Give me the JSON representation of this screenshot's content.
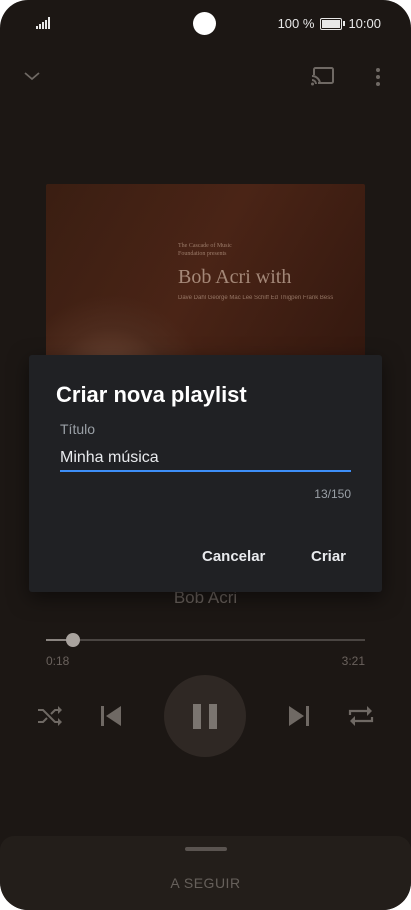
{
  "status_bar": {
    "battery": "100 %",
    "time": "10:00"
  },
  "player": {
    "album_art": {
      "line1": "The Cascade of Music Foundation presents",
      "line2": "Bob Acri with",
      "line3": "Dave Dahl  George Mac  Lee Schiff  Ed Thigpen  Frank Bess"
    },
    "artist": "Bob Acri",
    "progress": {
      "elapsed": "0:18",
      "total": "3:21",
      "fraction": 0.085
    },
    "up_next_label": "A SEGUIR"
  },
  "dialog": {
    "title": "Criar nova playlist",
    "field_label": "Título",
    "field_value": "Minha música",
    "counter": "13/150",
    "cancel_label": "Cancelar",
    "create_label": "Criar"
  },
  "colors": {
    "accent": "#3d8ef7",
    "dialog_bg": "#202124",
    "background": "#1c1714"
  },
  "icons": [
    "signal-icon",
    "battery-icon",
    "collapse-chevron-icon",
    "cast-icon",
    "more-vert-icon",
    "shuffle-icon",
    "previous-icon",
    "pause-icon",
    "next-icon",
    "repeat-icon"
  ]
}
